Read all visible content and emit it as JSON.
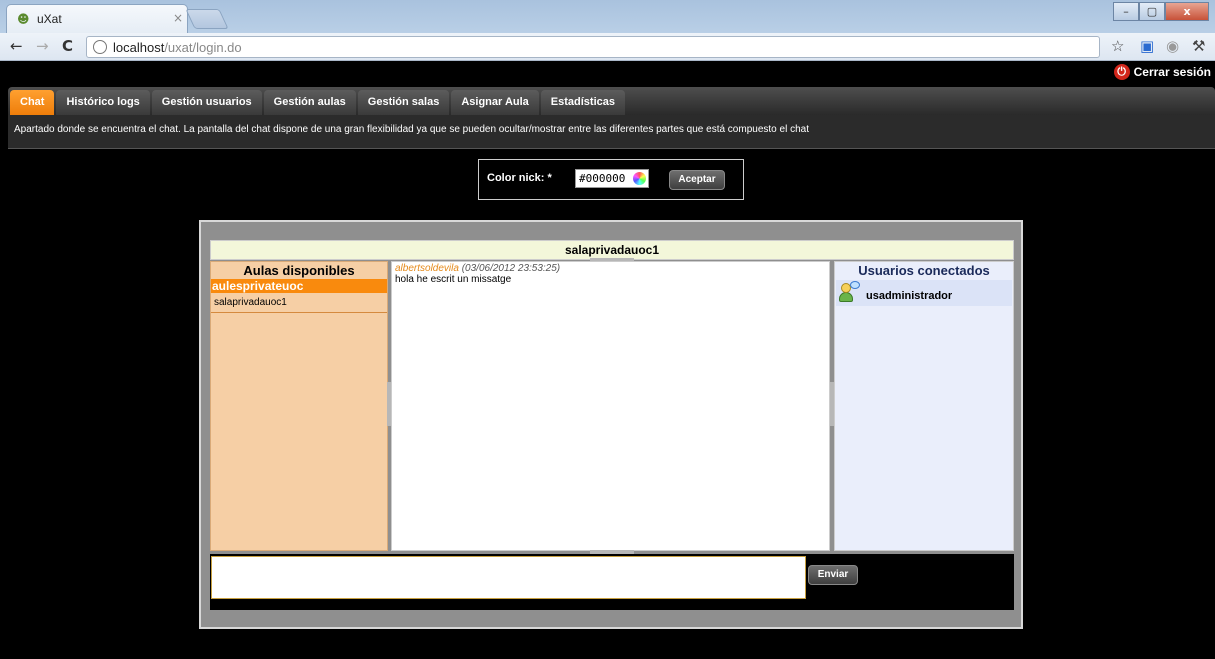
{
  "browser": {
    "tab_title": "uXat",
    "tab_close": "×",
    "url_host": "localhost",
    "url_path": "/uxat/login.do",
    "win_minimize": "–",
    "win_maximize": "▢",
    "win_close": "x"
  },
  "header": {
    "logout_label": "Cerrar sesión"
  },
  "menu": {
    "tabs": [
      {
        "label": "Chat",
        "active": true
      },
      {
        "label": "Histórico logs"
      },
      {
        "label": "Gestión usuarios"
      },
      {
        "label": "Gestión aulas"
      },
      {
        "label": "Gestión salas"
      },
      {
        "label": "Asignar Aula"
      },
      {
        "label": "Estadísticas"
      }
    ],
    "description": "Apartado donde se encuentra el chat. La pantalla del chat dispone de una gran flexibilidad ya que se pueden ocultar/mostrar entre las diferentes partes que está compuesto el chat",
    "active_color": "#f28410"
  },
  "color_form": {
    "label": "Color nick: *",
    "value": "#000000",
    "accept_label": "Aceptar"
  },
  "chat": {
    "room_title": "salaprivadauoc1",
    "rooms_panel": {
      "title": "Aulas disponibles",
      "group": "aulesprivateuoc",
      "rooms": [
        "salaprivadauoc1"
      ]
    },
    "messages": [
      {
        "author": "albertsoldevila",
        "date": "(03/06/2012 23:53:25)",
        "text": "hola he escrit un missatge"
      }
    ],
    "users_panel": {
      "title": "Usuarios conectados",
      "users": [
        "usadministrador"
      ]
    },
    "send_label": "Enviar"
  }
}
